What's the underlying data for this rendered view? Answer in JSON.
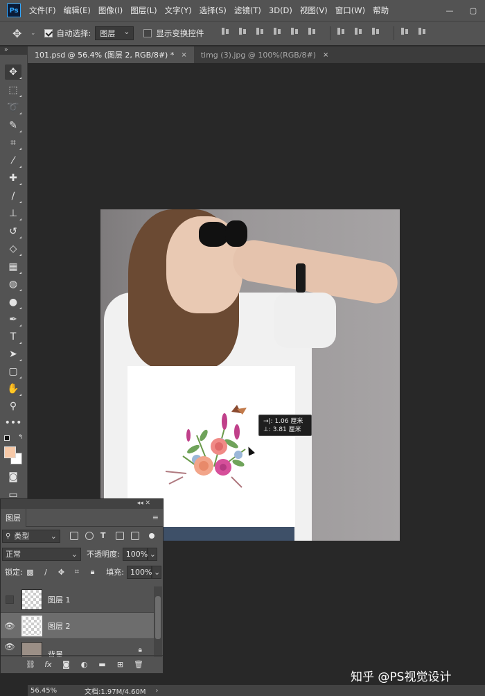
{
  "app": {
    "logo": "Ps"
  },
  "menu": [
    "文件(F)",
    "编辑(E)",
    "图像(I)",
    "图层(L)",
    "文字(Y)",
    "选择(S)",
    "滤镜(T)",
    "3D(D)",
    "视图(V)",
    "窗口(W)",
    "帮助"
  ],
  "options": {
    "auto_select_label": "自动选择:",
    "auto_select_checked": true,
    "auto_select_target": "图层",
    "transform_controls_label": "显示变换控件",
    "transform_controls_checked": false
  },
  "tabs": [
    {
      "label": "101.psd @ 56.4% (图层 2, RGB/8#) *",
      "close": "×",
      "active": true
    },
    {
      "label": "timg (3).jpg @ 100%(RGB/8#)",
      "close": "×",
      "active": false
    }
  ],
  "toolbar": {
    "tools": [
      "move-tool",
      "marquee-tool",
      "lasso-tool",
      "quick-select-tool",
      "crop-tool",
      "eyedropper-tool",
      "healing-tool",
      "brush-tool",
      "stamp-tool",
      "history-brush-tool",
      "eraser-tool",
      "gradient-tool",
      "blur-tool",
      "dodge-tool",
      "pen-tool",
      "type-tool",
      "path-select-tool",
      "shape-tool",
      "hand-tool",
      "zoom-tool",
      "more-tools"
    ],
    "foreground_color": "#f7c9a8",
    "background_color": "#ffffff"
  },
  "measure": {
    "dx": "→|: 1.06 厘米",
    "dy": "⊥: 3.81 厘米"
  },
  "layers_panel": {
    "title": "图层",
    "filter_kind": "类型",
    "blend_mode": "正常",
    "opacity_label": "不透明度:",
    "opacity_value": "100%",
    "lock_label": "锁定:",
    "fill_label": "填充:",
    "fill_value": "100%",
    "layers": [
      {
        "name": "图层 1",
        "visible": false,
        "selected": false
      },
      {
        "name": "图层 2",
        "visible": true,
        "selected": true
      },
      {
        "name": "背景",
        "visible": true,
        "selected": false,
        "locked": true
      }
    ]
  },
  "status": {
    "zoom": "56.45%",
    "doc": "文档:1.97M/4.60M",
    "arrow": "›"
  },
  "watermark": "知乎 @PS视觉设计"
}
